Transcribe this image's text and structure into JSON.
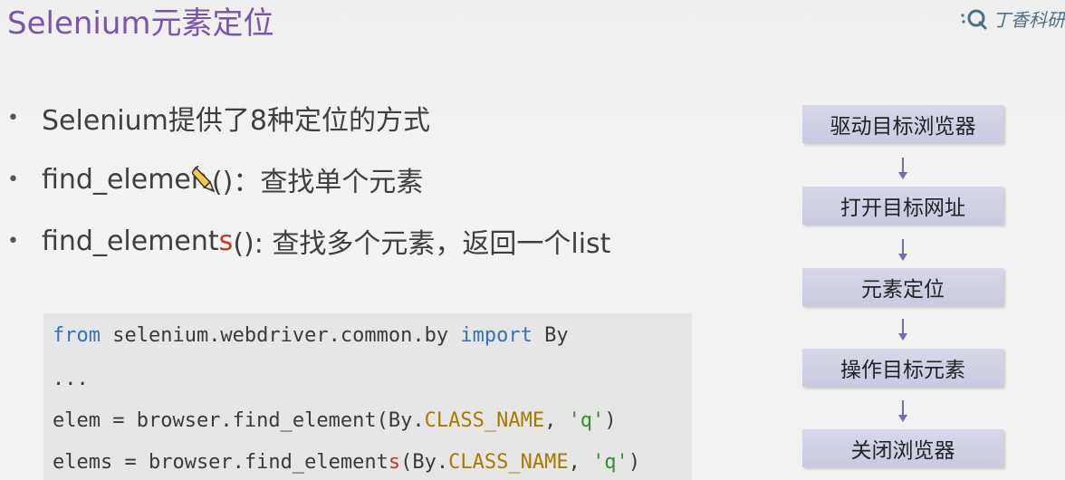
{
  "header": {
    "title": "Selenium元素定位",
    "logo_text": "丁香科研",
    "logo_icon": "magnifier-q-icon"
  },
  "bullets": [
    {
      "marker": "•",
      "text": "Selenium提供了8种定位的方式"
    },
    {
      "marker": "•",
      "text_before": "find_elemen",
      "cursor_icon": "pencil-cursor-icon",
      "text_after": "()：查找单个元素"
    },
    {
      "marker": "•",
      "text_before": "find_element",
      "highlight": "s",
      "text_after": "(): 查找多个元素，返回一个list"
    }
  ],
  "code": {
    "line1": {
      "kw_from": "from",
      "module": " selenium.webdriver.common.by ",
      "kw_import": "import",
      "name": " By"
    },
    "line2": {
      "text": "..."
    },
    "line3": {
      "pre": "elem = browser.find_element(By.",
      "const": "CLASS_NAME",
      "mid": ", ",
      "str": "'q'",
      "post": ")"
    },
    "line4": {
      "pre": "elems = browser.find_element",
      "red_s": "s",
      "mid1": "(By.",
      "const": "CLASS_NAME",
      "mid2": ", ",
      "str": "'q'",
      "post": ")"
    }
  },
  "flow": {
    "steps": [
      "驱动目标浏览器",
      "打开目标网址",
      "元素定位",
      "操作目标元素",
      "关闭浏览器"
    ],
    "arrow_icon": "down-arrow-icon"
  },
  "colors": {
    "title": "#7a55a9",
    "step_bg": "#cfcfe4",
    "arrow": "#6f6fb0",
    "keyword": "#3b6fb6",
    "constant": "#a67b00",
    "string": "#3c8a35",
    "highlight": "#c0392b"
  }
}
